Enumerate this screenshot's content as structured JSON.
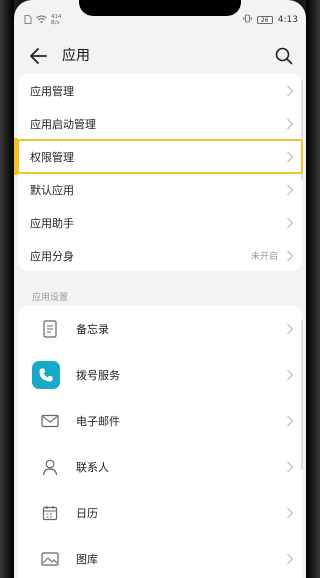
{
  "status_bar": {
    "speed_value": "414",
    "speed_unit": "B/s",
    "battery": "26",
    "time": "4:13"
  },
  "header": {
    "title": "应用",
    "back_icon": "arrow-left-icon",
    "search_icon": "search-icon"
  },
  "settings_list": [
    {
      "label": "应用管理"
    },
    {
      "label": "应用启动管理"
    },
    {
      "label": "权限管理",
      "highlighted": true
    },
    {
      "label": "默认应用"
    },
    {
      "label": "应用助手"
    },
    {
      "label": "应用分身",
      "value": "未开启"
    }
  ],
  "section": {
    "title": "应用设置"
  },
  "app_settings": [
    {
      "label": "备忘录",
      "icon": "notepad-icon"
    },
    {
      "label": "拨号服务",
      "icon": "phone-icon"
    },
    {
      "label": "电子邮件",
      "icon": "mail-icon"
    },
    {
      "label": "联系人",
      "icon": "contact-icon"
    },
    {
      "label": "日历",
      "icon": "calendar-icon"
    },
    {
      "label": "图库",
      "icon": "gallery-icon"
    }
  ],
  "colors": {
    "highlight": "#f3c22b",
    "phone_app": "#18a9c8",
    "background": "#f3f3f3"
  }
}
